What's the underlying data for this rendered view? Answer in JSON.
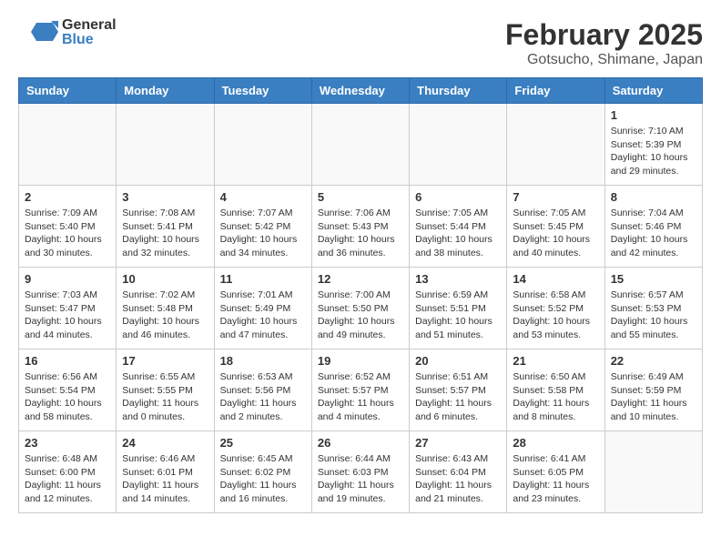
{
  "header": {
    "logo_general": "General",
    "logo_blue": "Blue",
    "month_title": "February 2025",
    "location": "Gotsucho, Shimane, Japan"
  },
  "calendar": {
    "days_of_week": [
      "Sunday",
      "Monday",
      "Tuesday",
      "Wednesday",
      "Thursday",
      "Friday",
      "Saturday"
    ],
    "weeks": [
      [
        {
          "day": "",
          "info": ""
        },
        {
          "day": "",
          "info": ""
        },
        {
          "day": "",
          "info": ""
        },
        {
          "day": "",
          "info": ""
        },
        {
          "day": "",
          "info": ""
        },
        {
          "day": "",
          "info": ""
        },
        {
          "day": "1",
          "info": "Sunrise: 7:10 AM\nSunset: 5:39 PM\nDaylight: 10 hours and 29 minutes."
        }
      ],
      [
        {
          "day": "2",
          "info": "Sunrise: 7:09 AM\nSunset: 5:40 PM\nDaylight: 10 hours and 30 minutes."
        },
        {
          "day": "3",
          "info": "Sunrise: 7:08 AM\nSunset: 5:41 PM\nDaylight: 10 hours and 32 minutes."
        },
        {
          "day": "4",
          "info": "Sunrise: 7:07 AM\nSunset: 5:42 PM\nDaylight: 10 hours and 34 minutes."
        },
        {
          "day": "5",
          "info": "Sunrise: 7:06 AM\nSunset: 5:43 PM\nDaylight: 10 hours and 36 minutes."
        },
        {
          "day": "6",
          "info": "Sunrise: 7:05 AM\nSunset: 5:44 PM\nDaylight: 10 hours and 38 minutes."
        },
        {
          "day": "7",
          "info": "Sunrise: 7:05 AM\nSunset: 5:45 PM\nDaylight: 10 hours and 40 minutes."
        },
        {
          "day": "8",
          "info": "Sunrise: 7:04 AM\nSunset: 5:46 PM\nDaylight: 10 hours and 42 minutes."
        }
      ],
      [
        {
          "day": "9",
          "info": "Sunrise: 7:03 AM\nSunset: 5:47 PM\nDaylight: 10 hours and 44 minutes."
        },
        {
          "day": "10",
          "info": "Sunrise: 7:02 AM\nSunset: 5:48 PM\nDaylight: 10 hours and 46 minutes."
        },
        {
          "day": "11",
          "info": "Sunrise: 7:01 AM\nSunset: 5:49 PM\nDaylight: 10 hours and 47 minutes."
        },
        {
          "day": "12",
          "info": "Sunrise: 7:00 AM\nSunset: 5:50 PM\nDaylight: 10 hours and 49 minutes."
        },
        {
          "day": "13",
          "info": "Sunrise: 6:59 AM\nSunset: 5:51 PM\nDaylight: 10 hours and 51 minutes."
        },
        {
          "day": "14",
          "info": "Sunrise: 6:58 AM\nSunset: 5:52 PM\nDaylight: 10 hours and 53 minutes."
        },
        {
          "day": "15",
          "info": "Sunrise: 6:57 AM\nSunset: 5:53 PM\nDaylight: 10 hours and 55 minutes."
        }
      ],
      [
        {
          "day": "16",
          "info": "Sunrise: 6:56 AM\nSunset: 5:54 PM\nDaylight: 10 hours and 58 minutes."
        },
        {
          "day": "17",
          "info": "Sunrise: 6:55 AM\nSunset: 5:55 PM\nDaylight: 11 hours and 0 minutes."
        },
        {
          "day": "18",
          "info": "Sunrise: 6:53 AM\nSunset: 5:56 PM\nDaylight: 11 hours and 2 minutes."
        },
        {
          "day": "19",
          "info": "Sunrise: 6:52 AM\nSunset: 5:57 PM\nDaylight: 11 hours and 4 minutes."
        },
        {
          "day": "20",
          "info": "Sunrise: 6:51 AM\nSunset: 5:57 PM\nDaylight: 11 hours and 6 minutes."
        },
        {
          "day": "21",
          "info": "Sunrise: 6:50 AM\nSunset: 5:58 PM\nDaylight: 11 hours and 8 minutes."
        },
        {
          "day": "22",
          "info": "Sunrise: 6:49 AM\nSunset: 5:59 PM\nDaylight: 11 hours and 10 minutes."
        }
      ],
      [
        {
          "day": "23",
          "info": "Sunrise: 6:48 AM\nSunset: 6:00 PM\nDaylight: 11 hours and 12 minutes."
        },
        {
          "day": "24",
          "info": "Sunrise: 6:46 AM\nSunset: 6:01 PM\nDaylight: 11 hours and 14 minutes."
        },
        {
          "day": "25",
          "info": "Sunrise: 6:45 AM\nSunset: 6:02 PM\nDaylight: 11 hours and 16 minutes."
        },
        {
          "day": "26",
          "info": "Sunrise: 6:44 AM\nSunset: 6:03 PM\nDaylight: 11 hours and 19 minutes."
        },
        {
          "day": "27",
          "info": "Sunrise: 6:43 AM\nSunset: 6:04 PM\nDaylight: 11 hours and 21 minutes."
        },
        {
          "day": "28",
          "info": "Sunrise: 6:41 AM\nSunset: 6:05 PM\nDaylight: 11 hours and 23 minutes."
        },
        {
          "day": "",
          "info": ""
        }
      ]
    ]
  }
}
